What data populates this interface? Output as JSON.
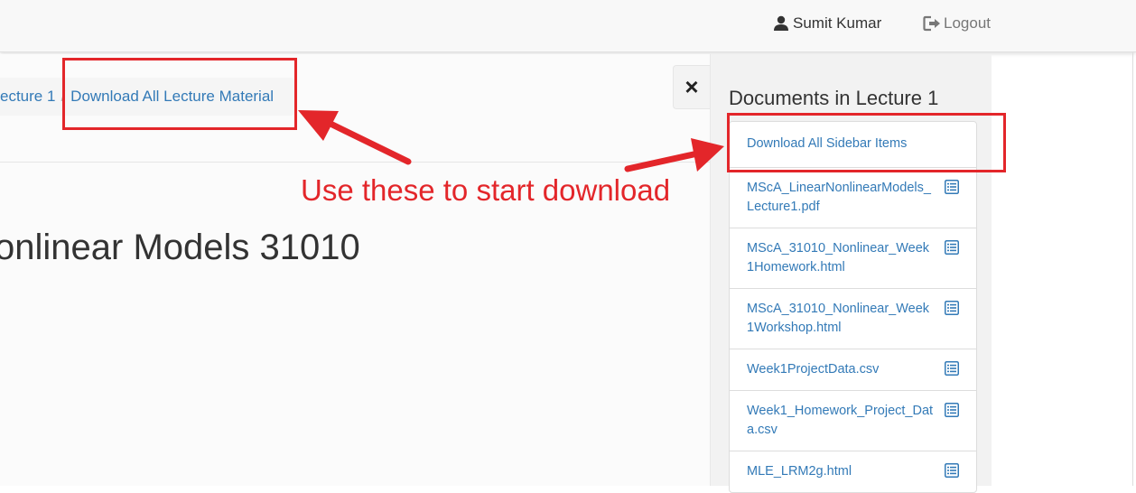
{
  "navbar": {
    "user_name": "Sumit Kumar",
    "logout_label": "Logout"
  },
  "breadcrumb": {
    "items": [
      "ecture 1",
      "Download All Lecture Material"
    ],
    "separator": "/"
  },
  "main": {
    "page_title": "onlinear Models 31010",
    "close_icon": "×"
  },
  "sidebar": {
    "title": "Documents in Lecture 1",
    "download_all_label": "Download All Sidebar Items",
    "documents": [
      {
        "name": "MScA_LinearNonlinearModels_Lecture1.pdf",
        "icon": "list-alt-icon"
      },
      {
        "name": "MScA_31010_Nonlinear_Week1Homework.html",
        "icon": "list-alt-icon"
      },
      {
        "name": "MScA_31010_Nonlinear_Week1Workshop.html",
        "icon": "list-alt-icon"
      },
      {
        "name": "Week1ProjectData.csv",
        "icon": "list-alt-icon"
      },
      {
        "name": "Week1_Homework_Project_Data.csv",
        "icon": "list-alt-icon"
      },
      {
        "name": "MLE_LRM2g.html",
        "icon": "list-alt-icon"
      }
    ]
  },
  "annotation": {
    "text": "Use these to start download",
    "color": "#e3262a"
  },
  "colors": {
    "link": "#337ab7",
    "annotation": "#e3262a"
  }
}
